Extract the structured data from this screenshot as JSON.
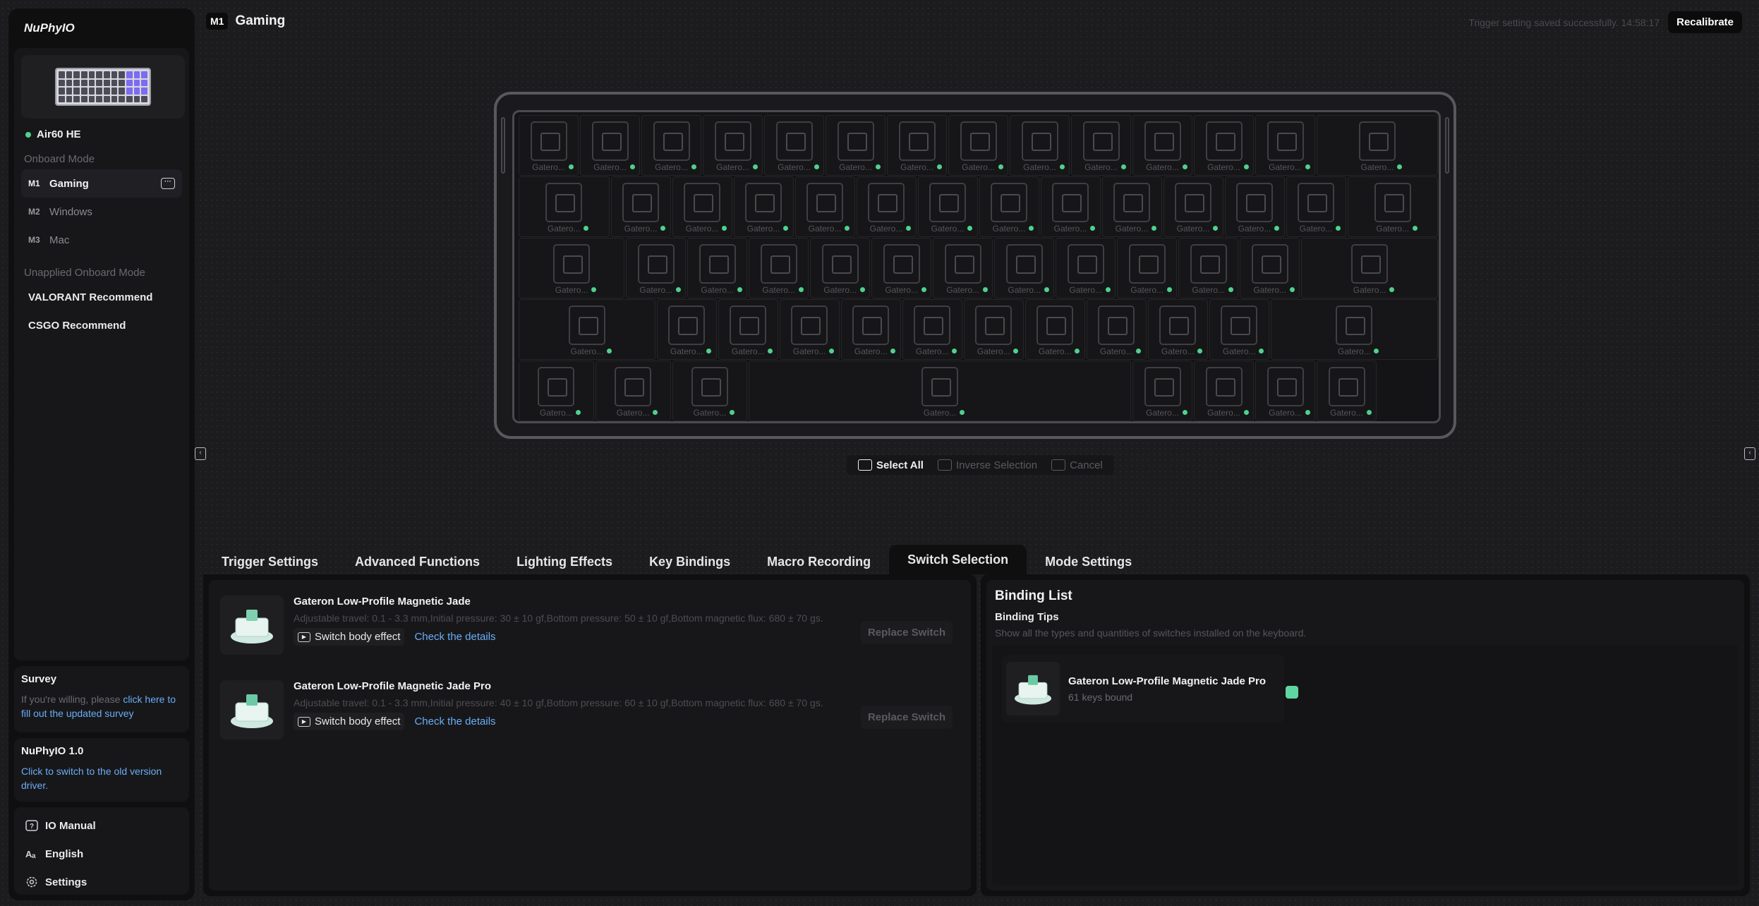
{
  "app": {
    "brand": "NuPhyIO"
  },
  "device": {
    "name": "Air60 HE",
    "status_color": "#4fd18b"
  },
  "onboard": {
    "title": "Onboard Mode",
    "modes": [
      {
        "tag": "M1",
        "label": "Gaming"
      },
      {
        "tag": "M2",
        "label": "Windows"
      },
      {
        "tag": "M3",
        "label": "Mac"
      }
    ],
    "unapplied_title": "Unapplied Onboard Mode",
    "recommends": [
      "VALORANT Recommend",
      "CSGO Recommend"
    ]
  },
  "survey": {
    "title": "Survey",
    "text": "If you're willing, please ",
    "link": "click here to fill out the updated survey"
  },
  "version": {
    "title": "NuPhyIO 1.0",
    "link": "Click to switch to the old version driver."
  },
  "bottom_menu": [
    {
      "icon": "manual-icon",
      "label": "IO Manual"
    },
    {
      "icon": "language-icon",
      "label": "English"
    },
    {
      "icon": "gear-icon",
      "label": "Settings"
    }
  ],
  "header": {
    "tag": "M1",
    "title": "Gaming",
    "status": "Trigger setting saved successfully. 14:58:17",
    "recalibrate": "Recalibrate"
  },
  "keyboard": {
    "key_label": "Gatero...",
    "rows": [
      14,
      14,
      13,
      12,
      8
    ]
  },
  "selection": {
    "select_all": "Select All",
    "inverse": "Inverse Selection",
    "cancel": "Cancel"
  },
  "tabs": [
    "Trigger Settings",
    "Advanced Functions",
    "Lighting Effects",
    "Key Bindings",
    "Macro Recording",
    "Switch Selection",
    "Mode Settings"
  ],
  "active_tab": "Switch Selection",
  "switches": [
    {
      "name": "Gateron Low-Profile Magnetic Jade",
      "desc": "Adjustable travel: 0.1 - 3.3 mm,Initial pressure: 30 ± 10 gf,Bottom pressure: 50 ± 10 gf,Bottom magnetic flux: 680 ± 70 gs.",
      "effect": "Switch body effect",
      "details": "Check the details",
      "replace": "Replace Switch"
    },
    {
      "name": "Gateron Low-Profile Magnetic Jade Pro",
      "desc": "Adjustable travel: 0.1 - 3.3 mm,Initial pressure: 40 ± 10 gf,Bottom pressure: 60 ± 10 gf,Bottom magnetic flux: 680 ± 70 gs.",
      "effect": "Switch body effect",
      "details": "Check the details",
      "replace": "Replace Switch"
    }
  ],
  "binding": {
    "title": "Binding List",
    "tips": "Binding Tips",
    "sub": "Show all the types and quantities of switches installed on the keyboard.",
    "item": {
      "name": "Gateron Low-Profile Magnetic Jade Pro",
      "count": "61 keys bound",
      "color": "#5fd6a0"
    }
  }
}
